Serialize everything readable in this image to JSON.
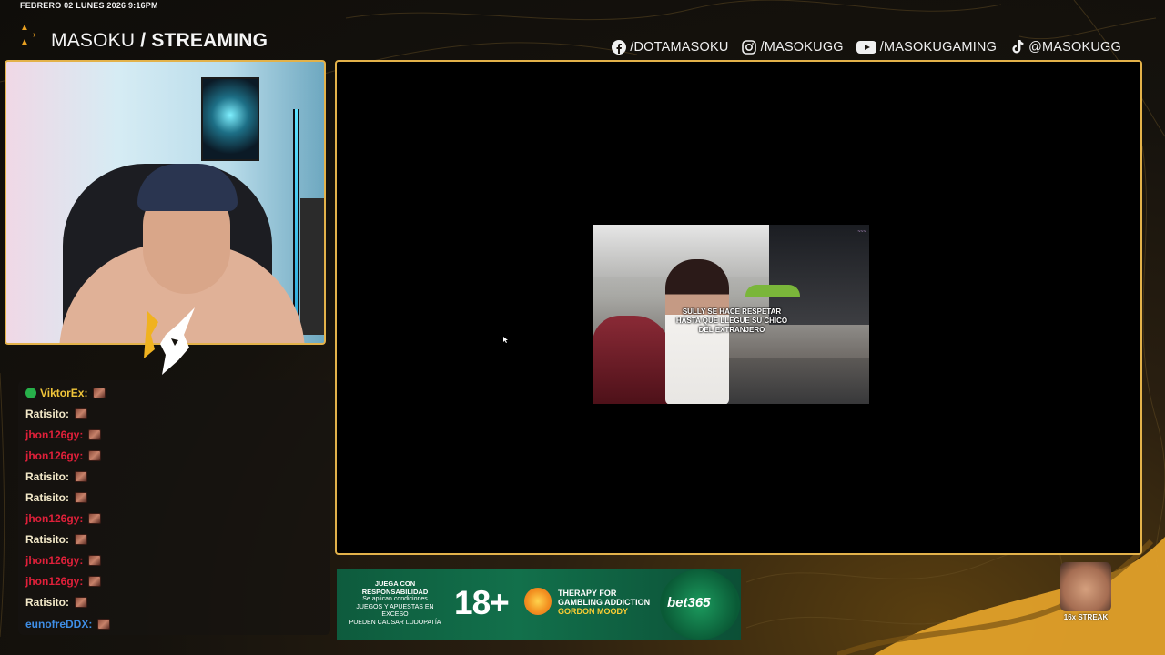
{
  "overlay": {
    "datetime": "FEBRERO 02 LUNES 2026 9:16PM",
    "brand_name": "MASOKU",
    "brand_separator": " / ",
    "brand_section": "STREAMING"
  },
  "socials": [
    {
      "icon": "facebook-icon",
      "label": "/DOTAMASOKU"
    },
    {
      "icon": "instagram-icon",
      "label": "/MASOKUGG"
    },
    {
      "icon": "youtube-icon",
      "label": "/MASOKUGAMING"
    },
    {
      "icon": "tiktok-icon",
      "label": "@MASOKUGG"
    }
  ],
  "chat": {
    "messages": [
      {
        "user": "ViktorEx:",
        "color": "#f0c53a",
        "badge": true
      },
      {
        "user": "Ratisito:",
        "color": "#f3e9c9",
        "badge": false
      },
      {
        "user": "jhon126gy:",
        "color": "#e0203a",
        "badge": false
      },
      {
        "user": "jhon126gy:",
        "color": "#e0203a",
        "badge": false
      },
      {
        "user": "Ratisito:",
        "color": "#f3e9c9",
        "badge": false
      },
      {
        "user": "Ratisito:",
        "color": "#f3e9c9",
        "badge": false
      },
      {
        "user": "jhon126gy:",
        "color": "#e0203a",
        "badge": false
      },
      {
        "user": "Ratisito:",
        "color": "#f3e9c9",
        "badge": false
      },
      {
        "user": "jhon126gy:",
        "color": "#e0203a",
        "badge": false
      },
      {
        "user": "jhon126gy:",
        "color": "#e0203a",
        "badge": false
      },
      {
        "user": "Ratisito:",
        "color": "#f3e9c9",
        "badge": false
      },
      {
        "user": "eunofreDDX:",
        "color": "#3f8ee6",
        "badge": false
      }
    ]
  },
  "video": {
    "caption_line1": "SULLY SE HACE RESPETAR",
    "caption_line2": "HASTA QUE LLEGUE SU CHICO",
    "caption_line3": "DEL EXTRANJERO"
  },
  "ad": {
    "resp_title": "JUEGA CON RESPONSABILIDAD",
    "resp_sub": "Se aplican condiciones",
    "resp_line1": "JUEGOS Y APUESTAS EN EXCESO",
    "resp_line2": "PUEDEN CAUSAR LUDOPATÍA",
    "age": "18+",
    "therapy_line1": "THERAPY FOR",
    "therapy_line2": "GAMBLING ADDICTION",
    "therapy_line3": "GORDON MOODY",
    "brand": "bet365"
  },
  "streak": {
    "label": "16x STREAK"
  },
  "colors": {
    "accent_gold": "#e3b24a",
    "brand_orange": "#e8a020"
  }
}
